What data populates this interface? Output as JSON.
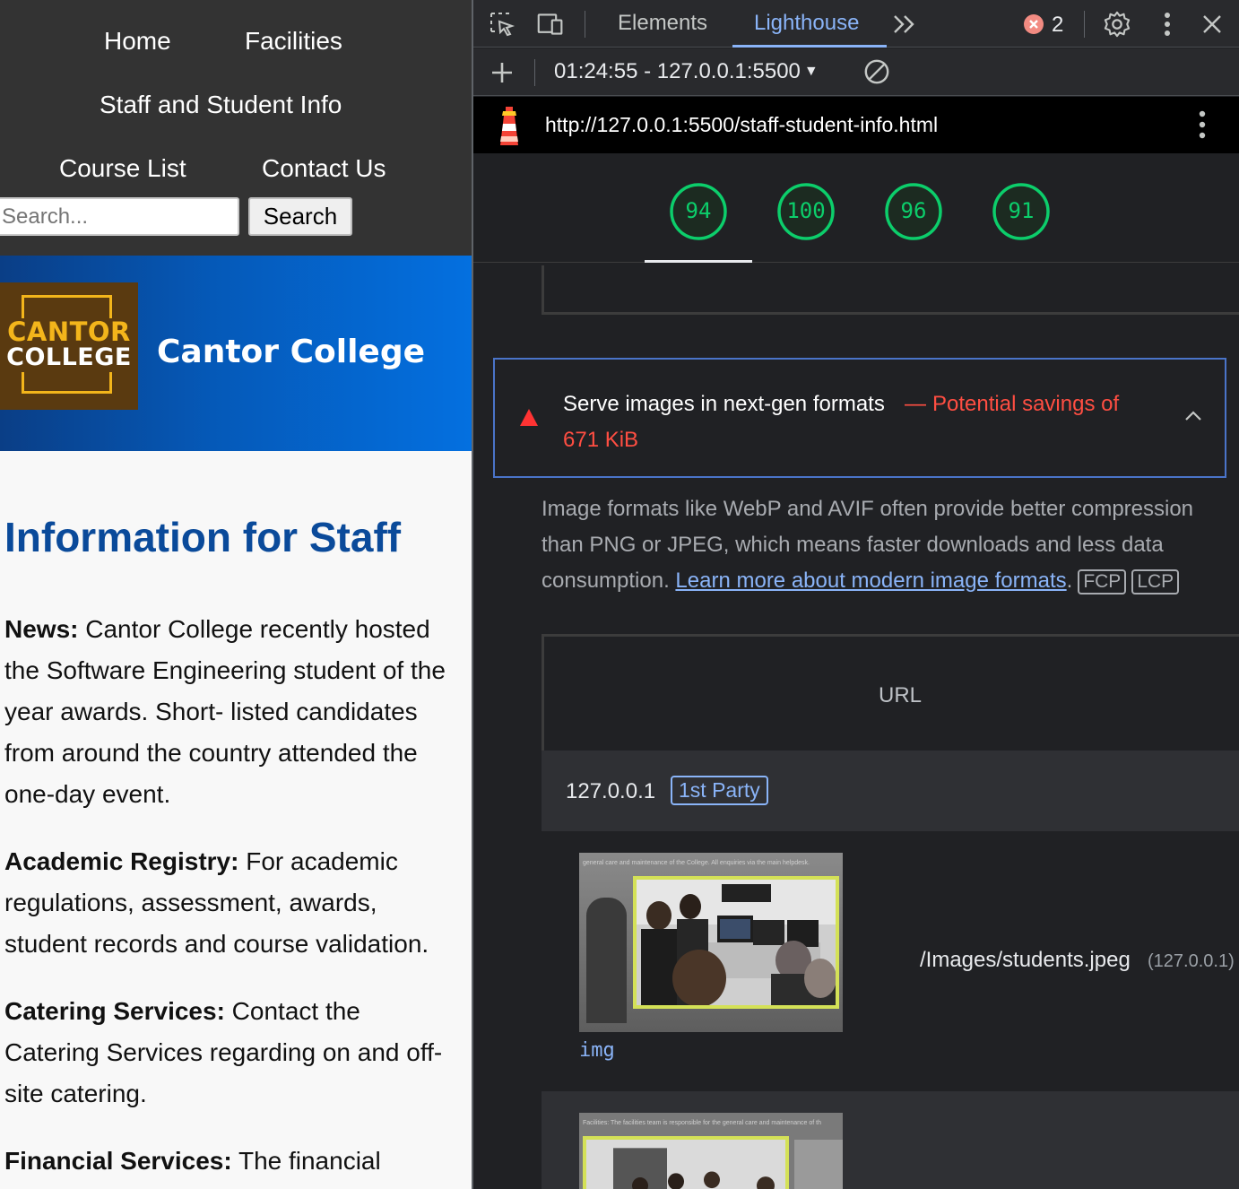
{
  "site": {
    "nav": {
      "home": "Home",
      "facilities": "Facilities",
      "staff_info": "Staff and Student Info",
      "course_list": "Course List",
      "contact": "Contact Us"
    },
    "search": {
      "placeholder": "Search...",
      "button": "Search"
    },
    "logo": {
      "line1": "CANTOR",
      "line2": "COLLEGE"
    },
    "college_name": "Cantor College",
    "page_title": "Information for Staff",
    "sections": [
      {
        "label": "News:",
        "text": " Cantor College recently hosted the Software Engineering student of the year awards. Short- listed candidates from around the country attended the one-day event."
      },
      {
        "label": "Academic Registry:",
        "text": " For academic regulations, assessment, awards, student records and course validation."
      },
      {
        "label": "Catering Services:",
        "text": " Contact the Catering Services regarding on and off-site catering."
      },
      {
        "label": "Financial Services:",
        "text": " The financial"
      }
    ]
  },
  "devtools": {
    "tabs": {
      "elements": "Elements",
      "lighthouse": "Lighthouse",
      "more": "»"
    },
    "error_count": "2",
    "report_select": "01:24:55 - 127.0.0.1:5500",
    "report_url": "http://127.0.0.1:5500/staff-student-info.html",
    "scores": [
      94,
      100,
      96,
      91
    ],
    "score_color": "#0cce6b",
    "audit": {
      "title": "Serve images in next-gen formats",
      "dash": "—",
      "savings_label": "Potential savings of",
      "savings_value": "671 KiB",
      "description": "Image formats like WebP and AVIF often provide better compression than PNG or JPEG, which means faster downloads and less data consumption.",
      "link": "Learn more about modern image formats",
      "period": ".",
      "badges": [
        "FCP",
        "LCP"
      ],
      "column_url": "URL",
      "group_host": "127.0.0.1",
      "group_badge": "1st Party",
      "items": [
        {
          "thumb_caption": "general care and maintenance of the College. All enquiries via the main helpdesk.",
          "tag": "img",
          "url": "/Images/students.jpeg",
          "origin": "(127.0.0.1)"
        },
        {
          "thumb_caption": "Facilities: The facilities team is responsible for the general care and maintenance of th"
        }
      ]
    },
    "colors": {
      "accent": "#8ab4f8",
      "fail": "#ff4e42",
      "pass": "#0cce6b"
    }
  }
}
